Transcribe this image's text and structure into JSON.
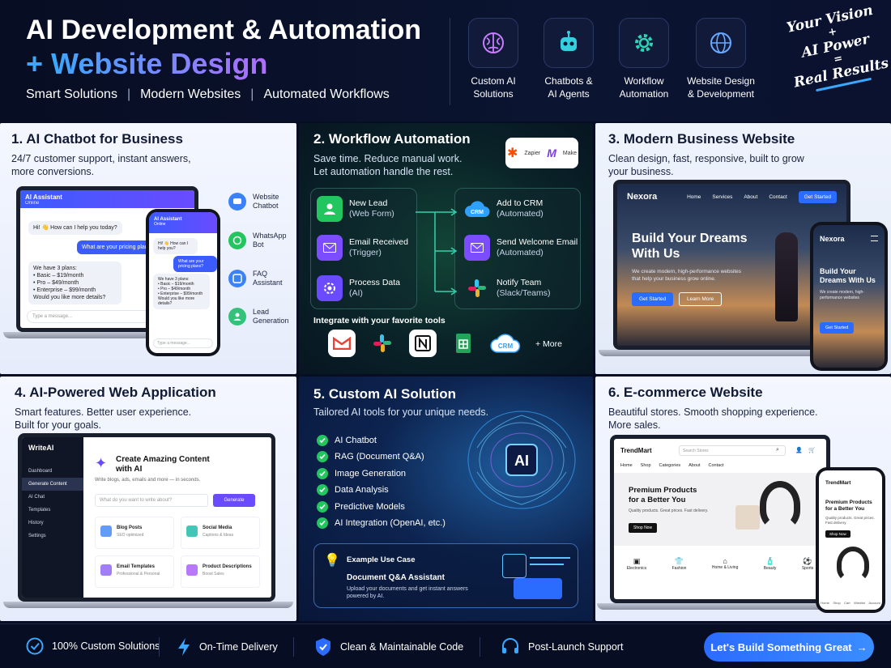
{
  "header": {
    "title_line1": "AI Development & Automation",
    "title_plus": "+",
    "title_line2": "Website Design",
    "subtitle": [
      "Smart Solutions",
      "Modern Websites",
      "Automated Workflows"
    ],
    "subtitle_sep": "|",
    "services": [
      {
        "label": "Custom AI\nSolutions",
        "icon": "brain-icon"
      },
      {
        "label": "Chatbots &\nAI Agents",
        "icon": "robot-icon"
      },
      {
        "label": "Workflow\nAutomation",
        "icon": "gear-icon"
      },
      {
        "label": "Website Design\n& Development",
        "icon": "globe-icon"
      }
    ],
    "tagline": [
      "Your Vision",
      "+",
      "AI Power",
      "=",
      "Real Results"
    ]
  },
  "panel1": {
    "title": "1. AI Chatbot for Business",
    "desc": "24/7 customer support, instant answers,\nmore conversions.",
    "chat_title": "AI Assistant",
    "chat_status": "Online",
    "msg1": "Hi! 👋 How can I help you today?",
    "msg2": "What are your pricing plans?",
    "msg3": "We have 3 plans:\n• Basic – $19/month\n• Pro – $49/month\n• Enterprise – $99/month\nWould you like more details?",
    "input_placeholder": "Type a message...",
    "phone_msg1": "Hi! 👋 How can I help you?",
    "phone_msg2": "What are your pricing plans?",
    "phone_msg3": "We have 3 plans:\n• Basic – $19/month\n• Pro – $49/month\n• Enterprise – $99/month\nWould you like more details?",
    "features": [
      {
        "label": "Website\nChatbot",
        "color": "#3b82f6"
      },
      {
        "label": "WhatsApp\nBot",
        "color": "#22c55e"
      },
      {
        "label": "FAQ\nAssistant",
        "color": "#3b82f6"
      },
      {
        "label": "Lead\nGeneration",
        "color": "#34c27a"
      }
    ]
  },
  "panel2": {
    "title": "2. Workflow Automation",
    "desc": "Save time. Reduce manual work.\nLet automation handle the rest.",
    "badge_zapier": "Zapier",
    "badge_make": "Make",
    "left_nodes": [
      {
        "title": "New Lead",
        "sub": "(Web Form)",
        "color": "#22c55e"
      },
      {
        "title": "Email Received",
        "sub": "(Trigger)",
        "color": "#7c4dff"
      },
      {
        "title": "Process Data",
        "sub": "(AI)",
        "color": "#6a4bff"
      }
    ],
    "right_nodes": [
      {
        "title": "Add to CRM",
        "sub": "(Automated)",
        "color": "#2ea0ff"
      },
      {
        "title": "Send Welcome Email",
        "sub": "(Automated)",
        "color": "#7c4dff"
      },
      {
        "title": "Notify Team",
        "sub": "(Slack/Teams)",
        "color": "#ffffff"
      }
    ],
    "crm_label": "CRM",
    "integrate_label": "Integrate with your favorite tools",
    "more_label": "+ More"
  },
  "panel3": {
    "title": "3. Modern Business Website",
    "desc": "Clean design, fast, responsive, built to grow\nyour business.",
    "brand": "Nexora",
    "nav": [
      "Home",
      "Services",
      "About",
      "Contact"
    ],
    "nav_cta": "Get Started",
    "hero_title": "Build Your Dreams\nWith Us",
    "hero_desc": "We create modern, high-performance websites\nthat help your business grow online.",
    "btn_primary": "Get Started",
    "btn_secondary": "Learn More",
    "phone_hero": "Build Your\nDreams With Us",
    "phone_desc": "We create modern, high-\nperformance websites"
  },
  "panel4": {
    "title": "4. AI-Powered Web Application",
    "desc": "Smart features. Better user experience.\nBuilt for your goals.",
    "app_name": "WriteAI",
    "sidebar": [
      "Dashboard",
      "Generate Content",
      "AI Chat",
      "Templates",
      "History",
      "Settings"
    ],
    "heading": "Create Amazing Content\nwith AI",
    "subheading": "Write blogs, ads, emails and more — in seconds.",
    "input_placeholder": "What do you want to write about?",
    "generate_label": "Generate",
    "cards": [
      {
        "title": "Blog Posts",
        "sub": "SEO optimized",
        "color": "#3b82f6"
      },
      {
        "title": "Social Media",
        "sub": "Captions & Ideas",
        "color": "#14b8a6"
      },
      {
        "title": "Email Templates",
        "sub": "Professional & Personal",
        "color": "#8b5cf6"
      },
      {
        "title": "Product Descriptions",
        "sub": "Boost Sales",
        "color": "#a855f7"
      }
    ]
  },
  "panel5": {
    "title": "5. Custom AI Solution",
    "desc": "Tailored AI tools for your unique needs.",
    "items": [
      "AI Chatbot",
      "RAG (Document Q&A)",
      "Image Generation",
      "Data Analysis",
      "Predictive Models",
      "AI Integration (OpenAI, etc.)"
    ],
    "chip": "AI",
    "example_label": "Example Use Case",
    "example_title": "Document Q&A Assistant",
    "example_desc": "Upload your documents and get instant answers\npowered by AI."
  },
  "panel6": {
    "title": "6. E-commerce Website",
    "desc": "Beautiful stores. Smooth shopping experience.\nMore sales.",
    "brand": "TrendMart",
    "search_placeholder": "Search Stores",
    "nav": [
      "Home",
      "Shop",
      "Categories",
      "About",
      "Contact"
    ],
    "hero_title": "Premium Products\nfor a Better You",
    "hero_desc": "Quality products. Great prices. Fast delivery.",
    "shop_label": "Shop Now",
    "categories": [
      "Electronics",
      "Fashion",
      "Home & Living",
      "Beauty",
      "Sports"
    ],
    "phone_hero": "Premium Products\nfor a Better You",
    "phone_desc": "Quality products. Great prices.\nFast delivery.",
    "phone_tabs": [
      "Home",
      "Shop",
      "Cart",
      "Wishlist",
      "Account"
    ]
  },
  "footer": {
    "items": [
      {
        "label": "100% Custom Solutions",
        "icon": "check-circle-icon"
      },
      {
        "label": "On-Time Delivery",
        "icon": "lightning-icon"
      },
      {
        "label": "Clean & Maintainable Code",
        "icon": "shield-icon"
      },
      {
        "label": "Post-Launch Support",
        "icon": "headset-icon"
      }
    ],
    "cta": "Let's Build Something Great",
    "cta_arrow": "→"
  }
}
